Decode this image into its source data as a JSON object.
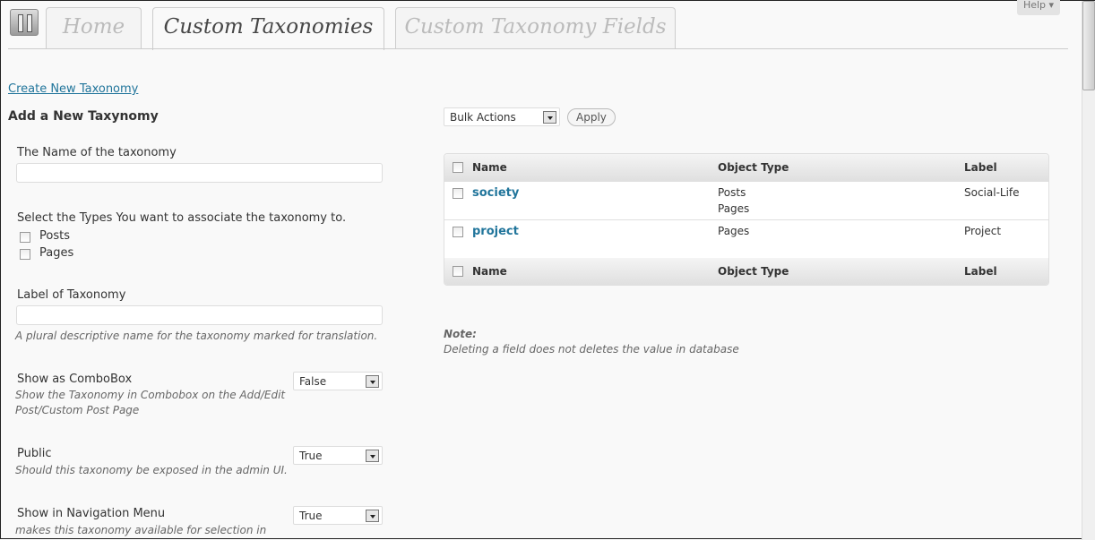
{
  "tabs": [
    {
      "label": "Home"
    },
    {
      "label": "Custom Taxonomies"
    },
    {
      "label": "Custom Taxonomy Fields"
    }
  ],
  "help": "Help ▾",
  "create_link": "Create New Taxonomy",
  "form": {
    "title": "Add a New Taxynomy",
    "name_label": "The Name of the taxonomy",
    "name_value": "",
    "types_label": "Select the Types You want to associate the taxonomy to.",
    "types": [
      "Posts",
      "Pages"
    ],
    "label_label": "Label of Taxonomy",
    "label_value": "",
    "label_desc": "A plural descriptive name for the taxonomy marked for translation.",
    "combo": {
      "label": "Show as ComboBox",
      "desc": "Show the Taxonomy in Combobox on the Add/Edit Post/Custom Post Page",
      "value": "False"
    },
    "public": {
      "label": "Public",
      "desc": "Should this taxonomy be exposed in the admin UI.",
      "value": "True"
    },
    "nav": {
      "label": "Show in Navigation Menu",
      "desc": "makes this taxonomy available for selection in",
      "value": "True"
    }
  },
  "bulk": {
    "selected": "Bulk Actions",
    "apply": "Apply"
  },
  "table": {
    "headers": [
      "Name",
      "Object Type",
      "Label"
    ],
    "rows": [
      {
        "name": "society",
        "types": [
          "Posts",
          "Pages"
        ],
        "label": "Social-Life"
      },
      {
        "name": "project",
        "types": [
          "Pages"
        ],
        "label": "Project"
      }
    ]
  },
  "note": {
    "title": "Note:",
    "text": "Deleting a field does not deletes the value in database"
  },
  "colors": {
    "link": "#21759b",
    "background": "#f9f9f9"
  }
}
